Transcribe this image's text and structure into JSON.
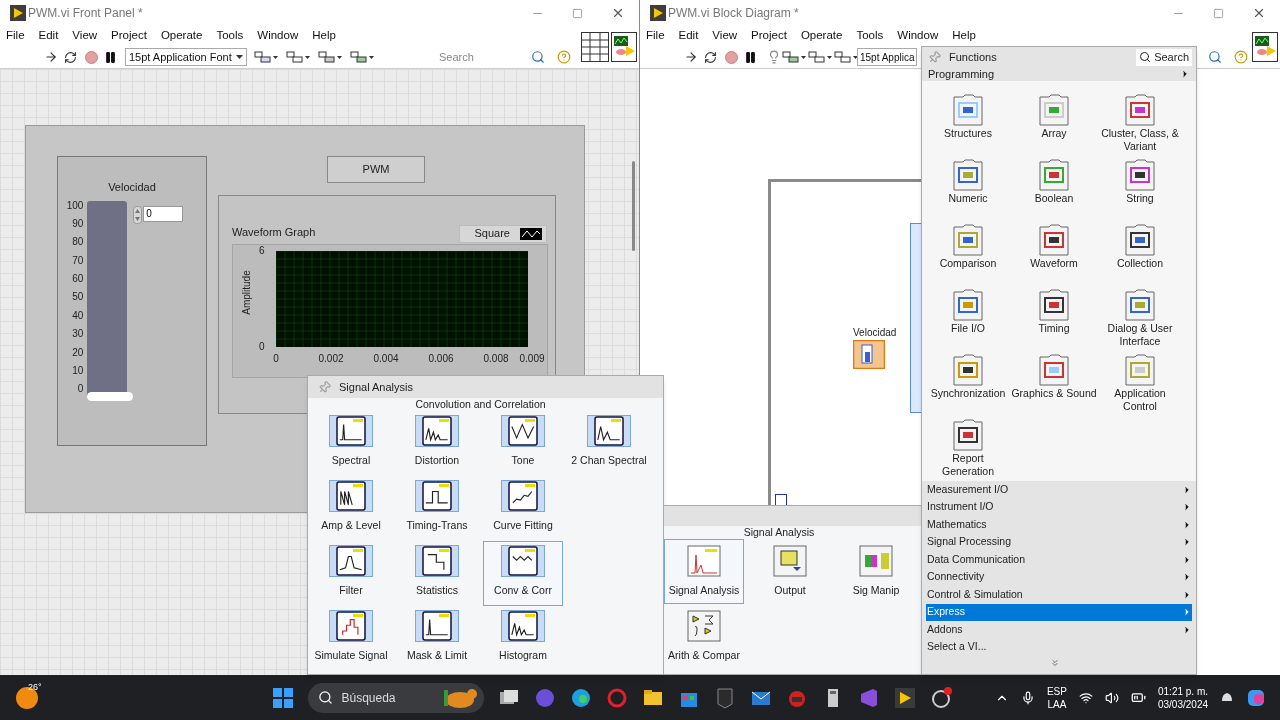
{
  "front_panel": {
    "title": "PWM.vi Front Panel *",
    "menu": [
      "File",
      "Edit",
      "View",
      "Project",
      "Operate",
      "Tools",
      "Window",
      "Help"
    ],
    "font_select": "15pt Application Font",
    "search": {
      "placeholder": "Search"
    },
    "slider": {
      "label": "Velocidad",
      "scale": [
        "100",
        "90",
        "80",
        "70",
        "60",
        "50",
        "40",
        "30",
        "20",
        "10",
        "0"
      ],
      "level": 0,
      "value": "0"
    },
    "button": "PWM",
    "graph": {
      "title": "Waveform Graph",
      "legend": "Square",
      "ylabel": "Amplitude",
      "yticks": [
        "6",
        "0"
      ],
      "xticks": [
        "0",
        "0.002",
        "0.004",
        "0.006",
        "0.008",
        "0.009"
      ]
    }
  },
  "block_diagram": {
    "title": "PWM.vi Block Diagram *",
    "menu": [
      "File",
      "Edit",
      "View",
      "Project",
      "Operate",
      "Tools",
      "Window",
      "Help"
    ],
    "font_select": "15pt Applica",
    "node_label": "Velocidad"
  },
  "signal_analysis_palette": {
    "title": "Signal Analysis",
    "hint": "Convolution and Correlation",
    "rows": [
      [
        {
          "label": "Spectral",
          "selected": false
        },
        {
          "label": "Distortion",
          "selected": false
        },
        {
          "label": "Tone",
          "selected": false
        },
        {
          "label": "2 Chan Spectral",
          "selected": false
        }
      ],
      [
        {
          "label": "Amp & Level",
          "selected": false
        },
        {
          "label": "Timing-Trans",
          "selected": false
        },
        {
          "label": "Curve Fitting",
          "selected": false
        }
      ],
      [
        {
          "label": "Filter",
          "selected": false
        },
        {
          "label": "Statistics",
          "selected": false
        },
        {
          "label": "Conv & Corr",
          "selected": true
        }
      ],
      [
        {
          "label": "Simulate Signal",
          "selected": false
        },
        {
          "label": "Mask & Limit",
          "selected": false
        },
        {
          "label": "Histogram",
          "selected": false
        }
      ]
    ]
  },
  "express_palette": {
    "title": "Signal Analysis",
    "items": [
      {
        "label": "Signal Analysis",
        "selected": true
      },
      {
        "label": "Output",
        "selected": false
      },
      {
        "label": "Sig Manip",
        "selected": false
      },
      {
        "label": "Arith & Compar",
        "selected": false
      }
    ]
  },
  "functions_palette": {
    "title": "Functions",
    "search": "Search",
    "category": "Programming",
    "items": [
      "Structures",
      "Array",
      "Cluster, Class, & Variant",
      "Numeric",
      "Boolean",
      "String",
      "Comparison",
      "Waveform",
      "Collection",
      "File I/O",
      "Timing",
      "Dialog & User Interface",
      "Synchronization",
      "Graphics & Sound",
      "Application Control",
      "Report Generation"
    ],
    "categories": [
      {
        "label": "Measurement I/O",
        "selected": false,
        "submenu": true
      },
      {
        "label": "Instrument I/O",
        "selected": false,
        "submenu": true
      },
      {
        "label": "Mathematics",
        "selected": false,
        "submenu": true
      },
      {
        "label": "Signal Processing",
        "selected": false,
        "submenu": true
      },
      {
        "label": "Data Communication",
        "selected": false,
        "submenu": true
      },
      {
        "label": "Connectivity",
        "selected": false,
        "submenu": true
      },
      {
        "label": "Control & Simulation",
        "selected": false,
        "submenu": true
      },
      {
        "label": "Express",
        "selected": true,
        "submenu": true
      },
      {
        "label": "Addons",
        "selected": false,
        "submenu": true
      },
      {
        "label": "Select a VI...",
        "selected": false,
        "submenu": false
      }
    ]
  },
  "taskbar": {
    "temperature": "26°",
    "search": "Búsqueda",
    "language": "ESP",
    "layout": "LAA",
    "time": "01:21 p. m.",
    "date": "03/03/2024"
  }
}
